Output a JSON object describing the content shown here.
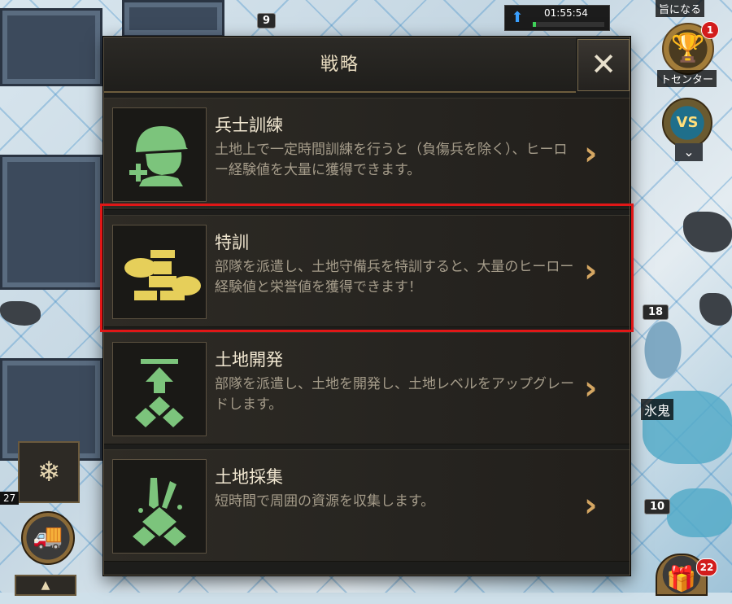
{
  "dialog": {
    "title": "戦略",
    "close_label": "✕",
    "items": [
      {
        "title": "兵士訓練",
        "description": "土地上で一定時間訓練を行うと（負傷兵を除く）、ヒーロー経験値を大量に獲得できます。",
        "icon": "soldier-training-icon"
      },
      {
        "title": "特訓",
        "description": "部隊を派遣し、土地守備兵を特訓すると、大量のヒーロー経験値と栄誉値を獲得できます！",
        "icon": "special-training-icon"
      },
      {
        "title": "土地開発",
        "description": "部隊を派遣し、土地を開発し、土地レベルをアップグレードします。",
        "icon": "land-development-icon"
      },
      {
        "title": "土地採集",
        "description": "短時間で周囲の資源を収集します。",
        "icon": "land-gathering-icon"
      }
    ]
  },
  "hud": {
    "top_level": "9",
    "timer": "01:55:54",
    "timer_progress": 0.04,
    "top_right_text": "旨になる",
    "trophy_badge": "1",
    "trophy_label": "トセンター",
    "level_18": "18",
    "level_10": "10",
    "monster_label": "氷鬼",
    "left_value": "27",
    "gift_badge": "22"
  },
  "colors": {
    "accent_gold": "#d4a662",
    "icon_green": "#7cc47c",
    "icon_yellow": "#e6cf5a",
    "highlight_red": "#e01717"
  }
}
